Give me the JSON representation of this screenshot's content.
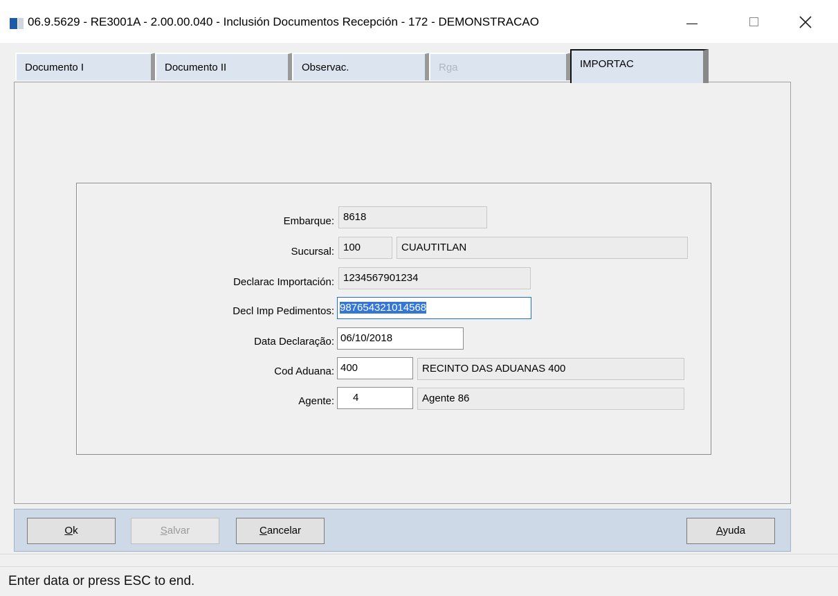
{
  "window": {
    "title": "06.9.5629 - RE3001A - 2.00.00.040 - Inclusión Documentos Recepción - 172 - DEMONSTRACAO",
    "minimize_icon": "minimize-icon",
    "maximize_icon": "maximize-icon",
    "close_icon": "close-icon"
  },
  "tabs": [
    {
      "label": "Documento I",
      "state": "normal"
    },
    {
      "label": "Documento II",
      "state": "normal"
    },
    {
      "label": "Observac.",
      "state": "normal"
    },
    {
      "label": "Rga",
      "state": "disabled"
    },
    {
      "label": "IMPORTAC",
      "state": "active"
    }
  ],
  "form": {
    "embarque": {
      "label": "Embarque:",
      "value": "8618"
    },
    "sucursal": {
      "label": "Sucursal:",
      "code": "100",
      "name": "CUAUTITLAN"
    },
    "declarac_importacion": {
      "label": "Declarac Importación:",
      "value": "1234567901234"
    },
    "decl_imp_pedimentos": {
      "label": "Decl Imp Pedimentos:",
      "value": "987654321014568"
    },
    "data_declaracao": {
      "label": "Data Declaração:",
      "value": "06/10/2018"
    },
    "cod_aduana": {
      "label": "Cod Aduana:",
      "code": "400",
      "name": "RECINTO DAS ADUANAS 400"
    },
    "agente": {
      "label": "Agente:",
      "code": "4",
      "name": "Agente 86"
    }
  },
  "buttons": {
    "ok": {
      "label_u": "O",
      "label_rest": "k"
    },
    "salvar": {
      "label_u": "S",
      "label_rest": "alvar"
    },
    "cancelar": {
      "label_u": "C",
      "label_rest": "ancelar"
    },
    "ayuda": {
      "label_u": "A",
      "label_rest": "yuda"
    }
  },
  "status": "Enter data or press ESC to end."
}
